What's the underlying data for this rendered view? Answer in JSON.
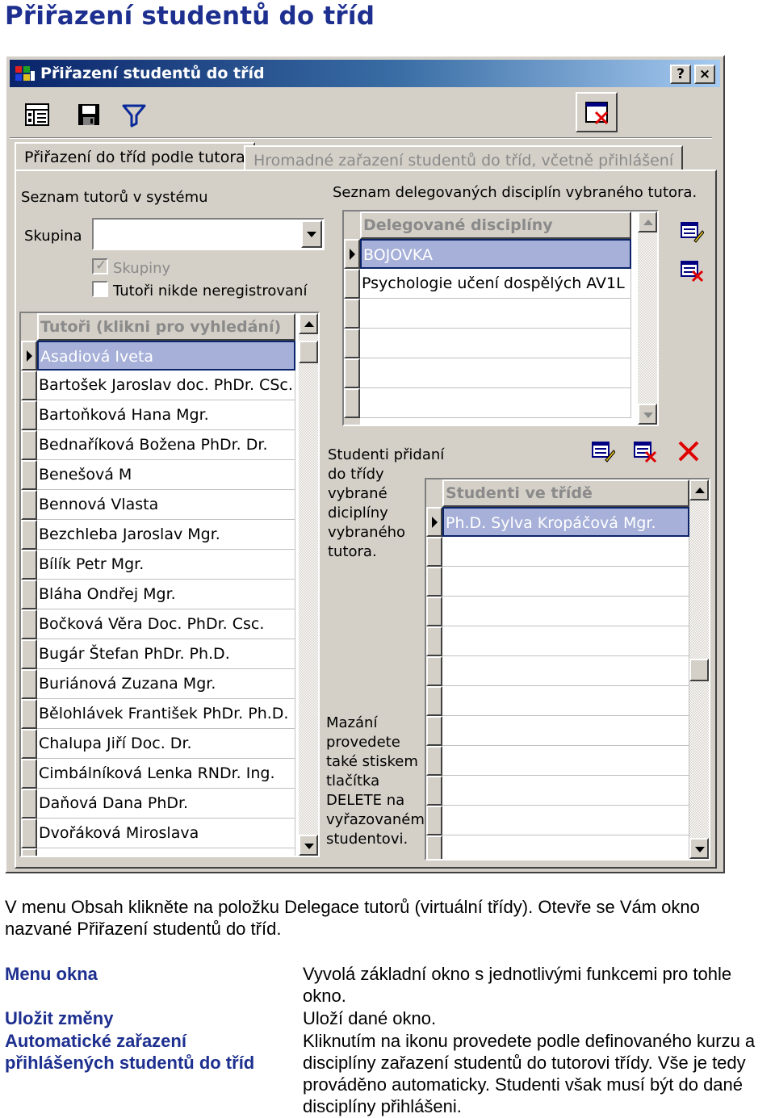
{
  "page_title": "Přiřazení studentů do tříd",
  "window": {
    "title": "Přiřazení studentů do tříd",
    "help_label": "?",
    "close_label": "×"
  },
  "tabs": [
    {
      "label": "Přiřazení do tříd podle tutora"
    },
    {
      "label": "Hromadné zařazení studentů do tříd, včetně přihlášení"
    }
  ],
  "left": {
    "section_label": "Seznam tutorů v systému",
    "group_label": "Skupina",
    "group_value": "",
    "chk_groups": "Skupiny",
    "chk_unregistered": "Tutoři nikde neregistrovaní",
    "grid_header": "Tutoři  (klikni pro vyhledání)",
    "tutors": [
      "Asadiová Iveta",
      "Bartošek Jaroslav doc. PhDr. CSc.",
      "Bartoňková Hana Mgr.",
      "Bednaříková Božena PhDr. Dr.",
      "Benešová M",
      "Bennová Vlasta",
      "Bezchleba Jaroslav Mgr.",
      "Bílík Petr Mgr.",
      "Bláha Ondřej Mgr.",
      "Bočková Věra Doc. PhDr. Csc.",
      "Bugár Štefan PhDr. Ph.D.",
      "Buriánová Zuzana Mgr.",
      "Bělohlávek František PhDr. Ph.D.",
      "Chalupa Jiří Doc. Dr.",
      "Cimbálníková Lenka RNDr. Ing.",
      "Daňová Dana PhDr.",
      "Dvořáková Miroslava"
    ]
  },
  "right": {
    "section_label": "Seznam delegovaných disciplín vybraného tutora.",
    "disciplines_header": "Delegované disciplíny",
    "disciplines": [
      "BOJOVKA",
      "Psychologie učení dospělých AV1L"
    ],
    "students_note": "Studenti přidaní\ndo třídy\nvybrané\ndiciplíny\nvybraného\ntutora.",
    "students_header": "Studenti ve třídě",
    "students": [
      "Ph.D. Sylva Kropáčová Mgr."
    ],
    "delete_note": "Mazání\nprovedete\ntaké stiskem\ntlačítka\nDELETE na\nvyřazovaném\nstudentovi."
  },
  "body": {
    "intro": "V menu Obsah klikněte na položku Delegace tutorů (virtuální třídy). Otevře se Vám okno nazvané Přiřazení studentů do tříd.",
    "items": [
      {
        "term": "Menu okna",
        "desc": "Vyvolá základní okno s jednotlivými funkcemi pro tohle okno."
      },
      {
        "term": "Uložit změny",
        "desc": "Uloží dané okno."
      },
      {
        "term": "Automatické zařazení přihlášených studentů do tříd",
        "desc": "Kliknutím na ikonu provedete podle definovaného kurzu a disciplíny zařazení studentů do tutorovi třídy. Vše je tedy prováděno automaticky. Studenti však musí být do dané disciplíny přihlášeni."
      }
    ]
  },
  "colors": {
    "title_blue": "#1d2f8f",
    "selection": "#a6b0d8",
    "face": "#d4d0c8"
  }
}
